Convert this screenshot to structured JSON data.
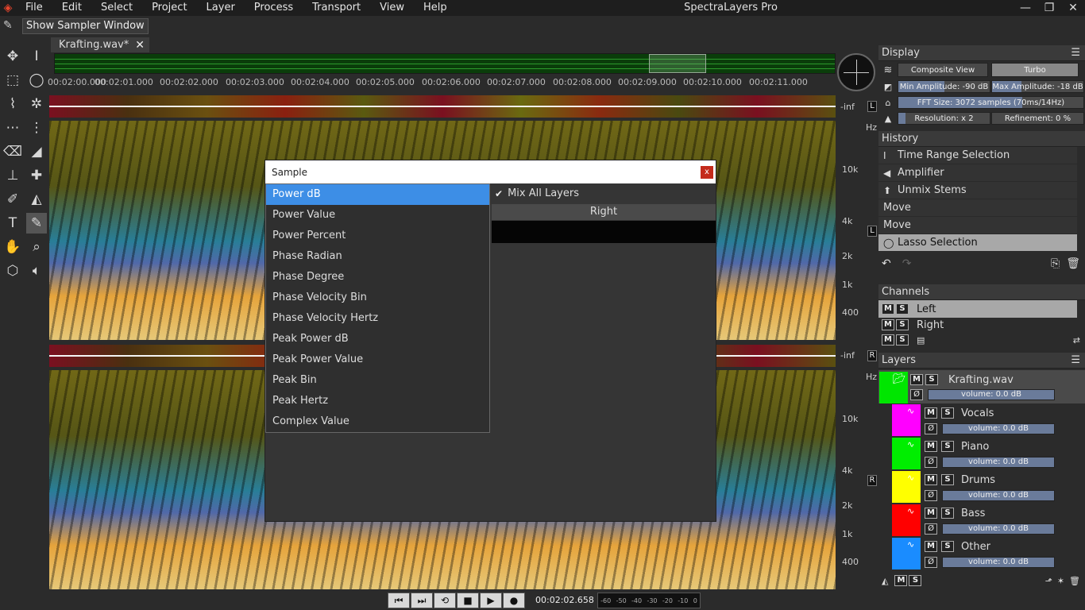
{
  "app": {
    "title": "SpectraLayers Pro"
  },
  "menu": [
    "File",
    "Edit",
    "Select",
    "Project",
    "Layer",
    "Process",
    "Transport",
    "View",
    "Help"
  ],
  "window_controls": [
    "—",
    "❐",
    "✕"
  ],
  "tooltip": "Show Sampler Window",
  "tab": {
    "label": "Krafting.wav*",
    "close": "✕"
  },
  "ruler_ticks": [
    "00:02:00.000",
    "00:02:01.000",
    "00:02:02.000",
    "00:02:03.000",
    "00:02:04.000",
    "00:02:05.000",
    "00:02:06.000",
    "00:02:07.000",
    "00:02:08.000",
    "00:02:09.000",
    "00:02:10.000",
    "00:02:11.000"
  ],
  "channels_view": {
    "top": {
      "inf": "-inf",
      "tag": "L",
      "hz": "Hz",
      "freqs": [
        "10k",
        "4k",
        "2k",
        "1k",
        "400"
      ]
    },
    "bottom": {
      "inf": "-inf",
      "tag": "R",
      "hz": "Hz",
      "freqs": [
        "10k",
        "4k",
        "2k",
        "1k",
        "400"
      ]
    }
  },
  "display": {
    "header": "Display",
    "view_button": "Composite View",
    "colormap": "Turbo",
    "min_amp": "Min Amplitude: -90 dB",
    "max_amp": "Max Amplitude: -18 dB",
    "fft": "FFT Size: 3072 samples (70ms/14Hz)",
    "resolution": "Resolution: x 2",
    "refinement": "Refinement: 0 %"
  },
  "history": {
    "header": "History",
    "items": [
      "Time Range Selection",
      "Amplifier",
      "Unmix Stems",
      "Move",
      "Move",
      "Lasso Selection"
    ]
  },
  "channels": {
    "header": "Channels",
    "items": [
      "Left",
      "Right"
    ]
  },
  "layers": {
    "header": "Layers",
    "parent": {
      "name": "Krafting.wav",
      "volume": "volume: 0.0 dB",
      "color": "#00e600"
    },
    "children": [
      {
        "name": "Vocals",
        "volume": "volume: 0.0 dB",
        "color": "#ff00ff"
      },
      {
        "name": "Piano",
        "volume": "volume: 0.0 dB",
        "color": "#00ee00"
      },
      {
        "name": "Drums",
        "volume": "volume: 0.0 dB",
        "color": "#ffff00"
      },
      {
        "name": "Bass",
        "volume": "volume: 0.0 dB",
        "color": "#ff0000"
      },
      {
        "name": "Other",
        "volume": "volume: 0.0 dB",
        "color": "#1a8cff"
      }
    ]
  },
  "buttons": {
    "mute": "M",
    "solo": "S",
    "phase": "Ø"
  },
  "transport": {
    "timecode": "00:02:02.658",
    "meter_labels": [
      "-60",
      "-50",
      "-40",
      "-30",
      "-20",
      "-10",
      "0"
    ]
  },
  "sample_dialog": {
    "title": "Sample",
    "close": "x",
    "mix_label": "Mix All Layers",
    "column": "Right",
    "options": [
      "Power dB",
      "Power Value",
      "Power Percent",
      "Phase Radian",
      "Phase Degree",
      "Phase Velocity Bin",
      "Phase Velocity Hertz",
      "Peak Power dB",
      "Peak Power Value",
      "Peak Bin",
      "Peak Hertz",
      "Complex Value"
    ],
    "selected": "Power dB"
  }
}
